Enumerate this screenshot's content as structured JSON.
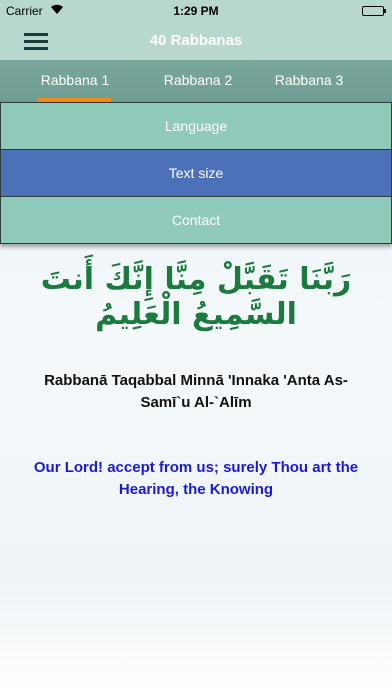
{
  "status_bar": {
    "carrier": "Carrier",
    "time": "1:29 PM"
  },
  "nav": {
    "title": "40 Rabbanas"
  },
  "tabs": [
    {
      "label": "Rabbana 1",
      "selected": true
    },
    {
      "label": "Rabbana 2",
      "selected": false
    },
    {
      "label": "Rabbana 3",
      "selected": false
    }
  ],
  "dropdown_menu": {
    "items": [
      {
        "label": "Language"
      },
      {
        "label": "Text size"
      },
      {
        "label": "Contact"
      }
    ]
  },
  "verse": {
    "arabic": "رَبَّنَا تَقَبَّلْ مِنَّا إِنَّكَ أَنتَ السَّمِيعُ الْعَلِيمُ",
    "transliteration": "Rabbanā Taqabbal Minnā 'Innaka 'Anta As-Samī`u Al-`Alīm",
    "translation": "Our Lord! accept from us; surely Thou art the Hearing, the Knowing"
  },
  "colors": {
    "header": "#b7d7cf",
    "tab_bar": "#7aa79d",
    "tab_indicator": "#f28a1c",
    "menu_item": "#8fcabb",
    "menu_item_highlight": "#4c71b8",
    "arabic_text": "#1b7a3d",
    "translation_text": "#1a1ad6"
  }
}
